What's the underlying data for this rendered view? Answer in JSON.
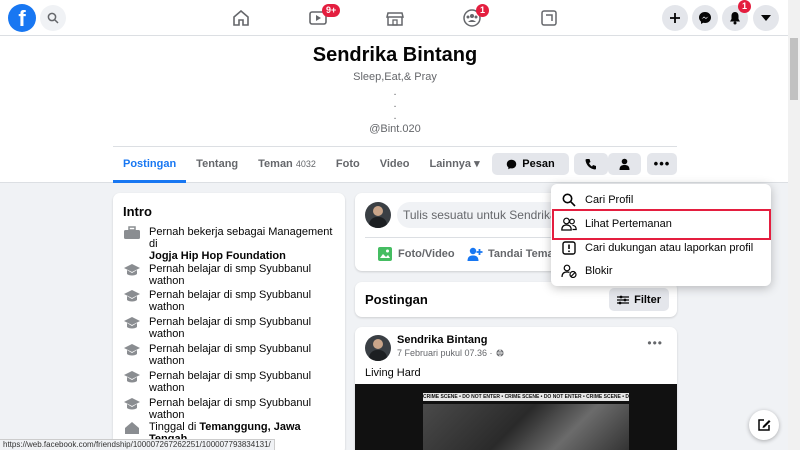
{
  "nav": {
    "logo": "f",
    "watch_badge": "9+",
    "groups_badge": "1",
    "notif_badge": "1"
  },
  "profile": {
    "name": "Sendrika Bintang",
    "bio_line1": "Sleep,Eat,& Pray",
    "dot": ".",
    "handle": "@Bint.020"
  },
  "tabs": {
    "posts": "Postingan",
    "about": "Tentang",
    "friends": "Teman",
    "friends_count": "4032",
    "photos": "Foto",
    "videos": "Video",
    "more": "Lainnya"
  },
  "actions": {
    "message": "Pesan"
  },
  "intro": {
    "title": "Intro",
    "work_prefix": "Pernah bekerja sebagai Management di",
    "work_place": "Jogja Hip Hop Foundation",
    "edu": "Pernah belajar di smp Syubbanul wathon",
    "lives_prefix": "Tinggal di",
    "lives_place": "Temanggung, Jawa Tengah,"
  },
  "composer": {
    "placeholder": "Tulis sesuatu untuk Sendrika...",
    "photo_video": "Foto/Video",
    "tag_friends": "Tandai Teman"
  },
  "posts_header": {
    "title": "Postingan",
    "filter": "Filter"
  },
  "post": {
    "author": "Sendrika Bintang",
    "time": "7 Februari pukul 07.36 ·",
    "text": "Living Hard",
    "tape_text": "CRIME SCENE • DO NOT ENTER • CRIME SCENE • DO NOT ENTER • CRIME SCENE • DO NOT ENTER"
  },
  "dropdown": {
    "items": [
      {
        "label": "Cari Profil"
      },
      {
        "label": "Lihat Pertemanan"
      },
      {
        "label": "Cari dukungan atau laporkan profil"
      },
      {
        "label": "Blokir"
      }
    ]
  },
  "statusbar": {
    "url": "https://web.facebook.com/friendship/100007267262251/100007793834131/"
  },
  "colors": {
    "brand": "#1877f2",
    "highlight": "#e41e3f"
  }
}
